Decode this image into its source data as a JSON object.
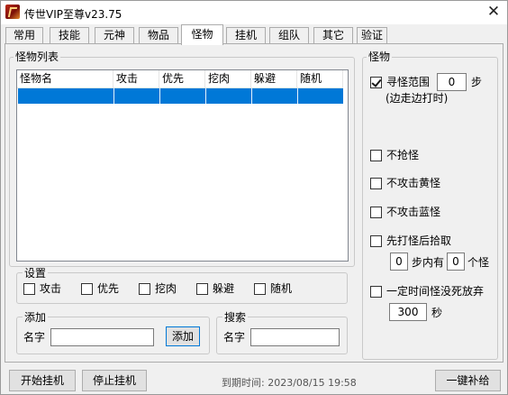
{
  "window": {
    "title": "传世VIP至尊v23.75",
    "close_glyph": "✕"
  },
  "tabs": [
    {
      "label": "常用"
    },
    {
      "label": "技能"
    },
    {
      "label": "元神"
    },
    {
      "label": "物品"
    },
    {
      "label": "怪物",
      "active": true
    },
    {
      "label": "挂机"
    },
    {
      "label": "组队"
    },
    {
      "label": "其它"
    },
    {
      "label": "验证"
    }
  ],
  "monster_list": {
    "group_label": "怪物列表",
    "columns": [
      "怪物名",
      "攻击",
      "优先",
      "挖肉",
      "躲避",
      "随机"
    ],
    "rows": [
      [
        "",
        "",
        "",
        "",
        "",
        ""
      ]
    ],
    "selection_color": "#0078d7"
  },
  "settings": {
    "group_label": "设置",
    "checkboxes": [
      {
        "label": "攻击",
        "checked": false
      },
      {
        "label": "优先",
        "checked": false
      },
      {
        "label": "挖肉",
        "checked": false
      },
      {
        "label": "躲避",
        "checked": false
      },
      {
        "label": "随机",
        "checked": false
      }
    ]
  },
  "add": {
    "group_label": "添加",
    "name_label": "名字",
    "name_value": "",
    "button_label": "添加"
  },
  "search": {
    "group_label": "搜索",
    "name_label": "名字",
    "name_value": ""
  },
  "monster_panel": {
    "group_label": "怪物",
    "search_range": {
      "label": "寻怪范围",
      "checked": true,
      "value": "0",
      "unit": "步",
      "note": "(边走边打时)"
    },
    "no_grab": {
      "label": "不抢怪",
      "checked": false
    },
    "no_yellow": {
      "label": "不攻击黄怪",
      "checked": false
    },
    "no_blue": {
      "label": "不攻击蓝怪",
      "checked": false
    },
    "kill_then_pick": {
      "label": "先打怪后拾取",
      "checked": false,
      "steps_value": "0",
      "steps_text": "步内有",
      "count_value": "0",
      "count_text": "个怪"
    },
    "timeout_give_up": {
      "label": "一定时间怪没死放弃",
      "checked": false,
      "value": "300",
      "unit": "秒"
    }
  },
  "bottom": {
    "start_label": "开始挂机",
    "stop_label": "停止挂机",
    "expiry_text": "到期时间: 2023/08/15 19:58",
    "refill_label": "一键补给"
  }
}
